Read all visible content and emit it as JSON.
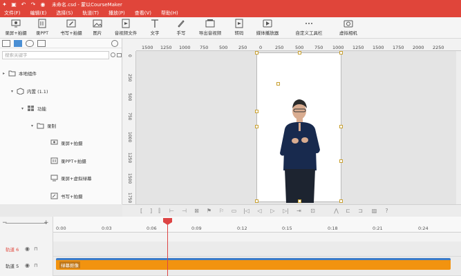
{
  "window": {
    "title": "未命名.csd - 蒙以CourseMaker"
  },
  "menu": [
    "文件(F)",
    "编辑(E)",
    "选择(S)",
    "轨道(T)",
    "播放(P)",
    "查看(V)",
    "帮助(H)"
  ],
  "toolbar": [
    {
      "label": "录屏+拍摄",
      "icon": "screen-record-icon"
    },
    {
      "label": "录PPT",
      "icon": "ppt-record-icon"
    },
    {
      "label": "书写+拍摄",
      "icon": "handwrite-record-icon"
    },
    {
      "label": "图片",
      "icon": "image-icon"
    },
    {
      "label": "音视频文件",
      "icon": "media-file-icon"
    },
    {
      "label": "文字",
      "icon": "text-icon"
    },
    {
      "label": "手写",
      "icon": "pen-icon"
    },
    {
      "label": "导出音视频",
      "icon": "export-icon"
    },
    {
      "label": "转码",
      "icon": "transcode-icon"
    },
    {
      "label": "媒体播放器",
      "icon": "media-player-icon"
    },
    {
      "label": "自定义工具栏",
      "icon": "more-icon"
    },
    {
      "label": "虚拟相机",
      "icon": "camera-icon"
    }
  ],
  "sidebar": {
    "search_placeholder": "搜索关键字",
    "tree": [
      {
        "label": "本地组件",
        "depth": 0,
        "expanded": true
      },
      {
        "label": "内置 (1.1)",
        "depth": 1,
        "expanded": true
      },
      {
        "label": "功能",
        "depth": 2,
        "expanded": true
      },
      {
        "label": "录制",
        "depth": 3,
        "expanded": true
      },
      {
        "label": "录屏+拍摄",
        "depth": 4
      },
      {
        "label": "录PPT+拍摄",
        "depth": 4
      },
      {
        "label": "录屏+虚拟绿幕",
        "depth": 4
      },
      {
        "label": "书写+拍摄",
        "depth": 4
      }
    ]
  },
  "ruler": {
    "h_labels": [
      "1500",
      "1250",
      "1000",
      "750",
      "500",
      "250",
      "0",
      "250",
      "500",
      "750",
      "1000",
      "1250",
      "1500",
      "1750",
      "2000",
      "2250"
    ],
    "v_labels": [
      "0",
      "250",
      "500",
      "750",
      "1000",
      "1250",
      "1500",
      "1750"
    ]
  },
  "timeline": {
    "time_labels": [
      "0:00",
      "0:03",
      "0:06",
      "0:09",
      "0:12",
      "0:15",
      "0:18",
      "0:21",
      "0:24"
    ],
    "tracks": [
      {
        "name": "轨道 6",
        "active": true
      },
      {
        "name": "轨道 5",
        "active": false
      }
    ],
    "clip_label": "绿幕抠像",
    "playhead_time": "0:06"
  },
  "colors": {
    "accent": "#e0453a",
    "clip": "#f2930f",
    "clip_top": "#3b7bc8",
    "playhead": "#dd4444"
  }
}
